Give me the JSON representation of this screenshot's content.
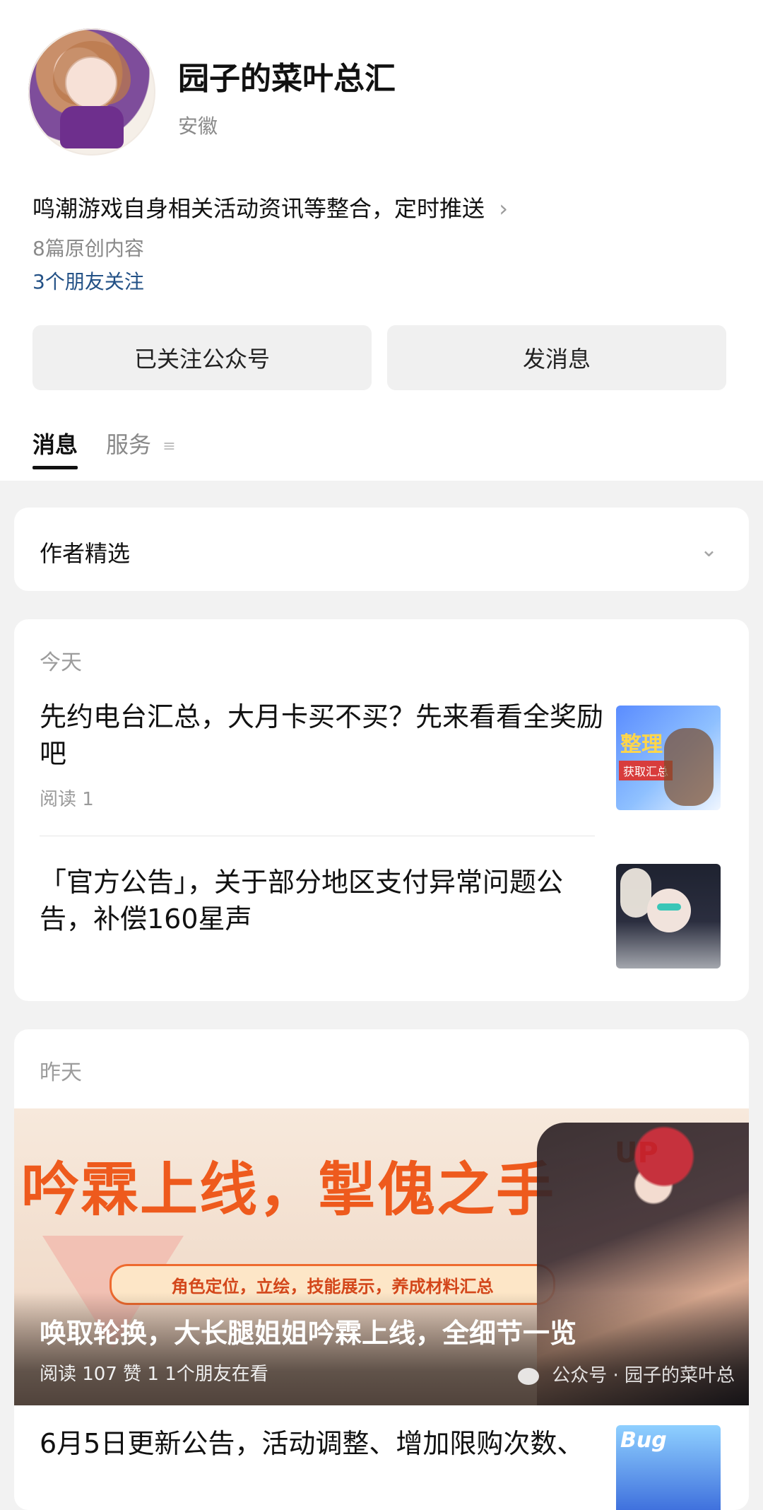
{
  "profile": {
    "title": "园子的菜叶总汇",
    "region": "安徽",
    "description": "鸣潮游戏自身相关活动资讯等整合，定时推送",
    "originals": "8篇原创内容",
    "friends": "3个朋友关注"
  },
  "actions": {
    "follow": "已关注公众号",
    "message": "发消息"
  },
  "tabs": [
    {
      "label": "消息",
      "active": true
    },
    {
      "label": "服务",
      "active": false
    }
  ],
  "author_picks": {
    "label": "作者精选"
  },
  "today": {
    "label": "今天",
    "articles": [
      {
        "title": "先约电台汇总，大月卡买不买？先来看看全奖励吧",
        "meta": "阅读 1",
        "thumb_text_1": "整理",
        "thumb_text_2": "获取汇总"
      },
      {
        "title": "「官方公告」，关于部分地区支付异常问题公告，补偿160星声"
      }
    ]
  },
  "yesterday": {
    "label": "昨天",
    "banner": {
      "headline": "吟霖上线，掣傀之手",
      "up": "UP",
      "ribbon": "角色定位，立绘，技能展示，养成材料汇总",
      "title": "唤取轮换，大长腿姐姐吟霖上线，全细节一览",
      "meta": "阅读 107  赞 1  1个朋友在看",
      "watermark": "公众号 · 园子的菜叶总"
    },
    "next_article": {
      "title": "6月5日更新公告，活动调整、增加限购次数、",
      "thumb_text": "Bug"
    }
  },
  "icons": {
    "chevron_right": "chevron-right-icon",
    "chevron_down": "chevron-down-icon",
    "menu": "menu-icon",
    "wechat": "wechat-icon"
  },
  "colors": {
    "link": "#235186",
    "banner_headline": "#ee5a1d"
  }
}
